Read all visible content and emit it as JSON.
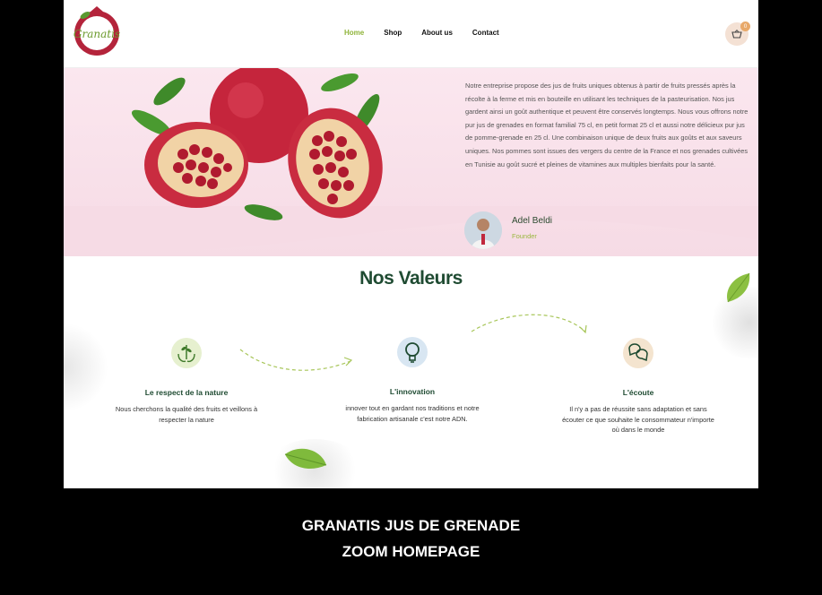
{
  "brand": {
    "logo_text": "Granatis"
  },
  "nav": {
    "items": [
      "Home",
      "Shop",
      "About us",
      "Contact"
    ]
  },
  "cart": {
    "count": "0"
  },
  "hero": {
    "text": "Notre entreprise propose des jus de fruits uniques obtenus à partir de fruits pressés après la récolte à la ferme et mis en bouteille en utilisant les techniques de la pasteurisation. Nos jus gardent ainsi un goût authentique et peuvent être conservés longtemps. Nous vous offrons notre pur jus de grenades en format familial 75 cl, en petit format 25 cl et aussi notre délicieux pur jus de pomme-grenade en 25 cl. Une combinaison unique de deux fruits aux goûts et aux saveurs uniques. Nos pommes sont issues des vergers du centre de la France et nos grenades cultivées en Tunisie au goût sucré et pleines de vitamines aux multiples bienfaits pour la santé.",
    "founder_name": "Adel Beldi",
    "founder_role": "Founder"
  },
  "values": {
    "title": "Nos Valeurs",
    "items": [
      {
        "icon": "hands-plant-icon",
        "title": "Le respect de la nature",
        "text": "Nous cherchons la qualité des fruits et veillons à respecter la nature"
      },
      {
        "icon": "lightbulb-icon",
        "title": "L'innovation",
        "text": "innover tout en gardant nos traditions et notre fabrication artisanale c'est notre ADN."
      },
      {
        "icon": "chat-bubbles-icon",
        "title": "L'écoute",
        "text": "Il n'y a pas de réussite sans adaptation et sans écouter ce que souhaite le consommateur n'importe où dans le monde"
      }
    ]
  },
  "caption": {
    "line1": "GRANATIS JUS DE GRENADE",
    "line2": "ZOOM HOMEPAGE"
  },
  "colors": {
    "accent_green": "#8fb43a",
    "dark_green": "#1f4b32",
    "hero_pink": "#f6dbe5",
    "pomegranate": "#b4243b"
  }
}
